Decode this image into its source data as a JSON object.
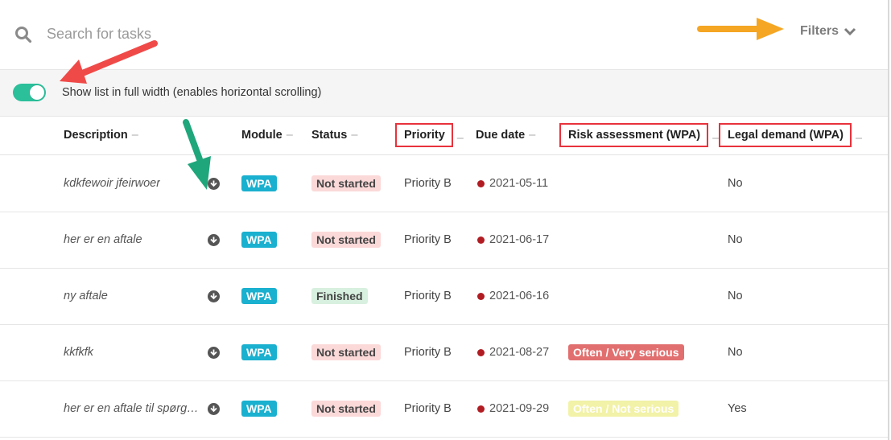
{
  "search": {
    "placeholder": "Search for tasks"
  },
  "filters": {
    "label": "Filters"
  },
  "toggle": {
    "label": "Show list in full width (enables horizontal scrolling)",
    "on": true
  },
  "colors": {
    "accent": "#2bbf9a",
    "module": "#1ab0cf",
    "highlight": "#e8323c",
    "arrow_red": "#f04a48",
    "arrow_orange": "#f5a623",
    "arrow_green": "#1fa67a"
  },
  "columns": {
    "description": "Description",
    "module": "Module",
    "status": "Status",
    "priority": "Priority",
    "due_date": "Due date",
    "risk": "Risk assessment (WPA)",
    "legal": "Legal demand (WPA)",
    "dash": "–"
  },
  "rows": [
    {
      "description": "kdkfewoir jfeirwoer",
      "module": "WPA",
      "status": "Not started",
      "priority": "Priority B",
      "due": "2021-05-11",
      "risk": "",
      "legal": "No"
    },
    {
      "description": "her er en aftale",
      "module": "WPA",
      "status": "Not started",
      "priority": "Priority B",
      "due": "2021-06-17",
      "risk": "",
      "legal": "No"
    },
    {
      "description": "ny aftale",
      "module": "WPA",
      "status": "Finished",
      "priority": "Priority B",
      "due": "2021-06-16",
      "risk": "",
      "legal": "No"
    },
    {
      "description": "kkfkfk",
      "module": "WPA",
      "status": "Not started",
      "priority": "Priority B",
      "due": "2021-08-27",
      "risk": "Often / Very serious",
      "legal": "No"
    },
    {
      "description": "her er en aftale til spørgs…",
      "module": "WPA",
      "status": "Not started",
      "priority": "Priority B",
      "due": "2021-09-29",
      "risk": "Often / Not serious",
      "legal": "Yes"
    }
  ]
}
